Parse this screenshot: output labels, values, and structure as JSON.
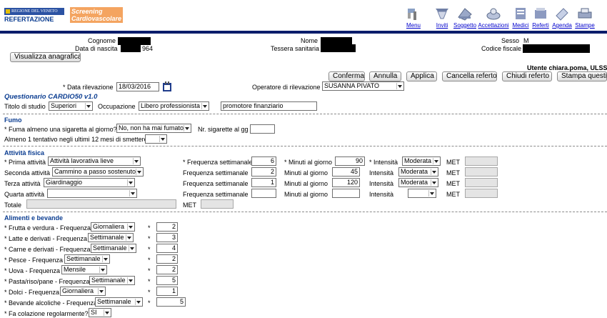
{
  "header": {
    "region_logo_text": "REGIONE DEL VENETO",
    "app_name": "REFERTAZIONE",
    "screening_line1": "Screening",
    "screening_line2": "Cardiovascolare"
  },
  "menu": [
    {
      "label": "Menu",
      "icon": "menu-icon"
    },
    {
      "label": "Inviti",
      "icon": "inviti-icon"
    },
    {
      "label": "Soggetto",
      "icon": "soggetto-icon"
    },
    {
      "label": "Accettazioni",
      "icon": "accettazioni-icon"
    },
    {
      "label": "Medici",
      "icon": "medici-icon"
    },
    {
      "label": "Referti",
      "icon": "referti-icon"
    },
    {
      "label": "Agenda",
      "icon": "agenda-icon"
    },
    {
      "label": "Stampe",
      "icon": "stampe-icon"
    }
  ],
  "patient": {
    "cognome_label": "Cognome",
    "nascita_label": "Data di nascita",
    "nascita_value": "964",
    "nome_label": "Nome",
    "tessera_label": "Tessera sanitaria",
    "sesso_label": "Sesso",
    "sesso_value": "M",
    "cf_label": "Codice fiscale",
    "anagrafica_button": "Visualizza anagrafica"
  },
  "user_line": "Utente chiara.poma, ULSS",
  "actions": {
    "conferma": "Conferma",
    "annulla": "Annulla",
    "applica": "Applica",
    "cancella": "Cancella referto",
    "chiudi": "Chiudi referto",
    "stampa": "Stampa questio"
  },
  "rilevazione": {
    "date_label": "* Data rilevazione",
    "date_value": "18/03/2016",
    "operatore_label": "Operatore di rilevazione",
    "operatore_value": "SUSANNA PIVATO"
  },
  "questionnaire_title": "Questionario CARDIO50 v1.0",
  "studio": {
    "titolo_label": "Titolo di studio",
    "titolo_value": "Superiori",
    "occupazione_label": "Occupazione",
    "occupazione_value": "Libero professionista",
    "occupazione_text": "promotore finanziario"
  },
  "fumo": {
    "title": "Fumo",
    "q1_label": "* Fuma almeno una sigaretta al giorno?",
    "q1_value": "No, non ha mai fumato",
    "nsig_label": "Nr. sigarette al gg",
    "nsig_value": "",
    "q2_label": "Almeno 1 tentativo negli ultimi 12 mesi di smettere",
    "q2_value": ""
  },
  "attivita": {
    "title": "Attività fisica",
    "rows": [
      {
        "label": "* Prima attività",
        "activity": "Attività lavorativa lieve",
        "freq_label": "* Frequenza settimanale",
        "freq": "6",
        "min_label": "* Minuti al giorno",
        "min": "90",
        "int_label": "* Intensità",
        "intensity": "Moderata",
        "met_label": "MET"
      },
      {
        "label": "Seconda attività",
        "activity": "Cammino a passo sostenuto",
        "freq_label": "Frequenza settimanale",
        "freq": "2",
        "min_label": "Minuti al giorno",
        "min": "45",
        "int_label": "Intensità",
        "intensity": "Moderata",
        "met_label": "MET"
      },
      {
        "label": "Terza attività",
        "activity": "Giardinaggio",
        "freq_label": "Frequenza settimanale",
        "freq": "1",
        "min_label": "Minuti al giorno",
        "min": "120",
        "int_label": "Intensità",
        "intensity": "Moderata",
        "met_label": "MET"
      },
      {
        "label": "Quarta attività",
        "activity": "",
        "freq_label": "Frequenza settimanale",
        "freq": "",
        "min_label": "Minuti al giorno",
        "min": "",
        "int_label": "Intensità",
        "intensity": "",
        "met_label": "MET"
      }
    ],
    "totale_label": "Totale",
    "totale_met_label": "MET"
  },
  "alimenti": {
    "title": "Alimenti e bevande",
    "rows": [
      {
        "label": "* Frutta e verdura - Frequenza",
        "freq": "Giornaliera",
        "qty": "2"
      },
      {
        "label": "* Latte e derivati - Frequenza",
        "freq": "Settimanale",
        "qty": "3"
      },
      {
        "label": "* Carne e derivati - Frequenza",
        "freq": "Settimanale",
        "qty": "4"
      },
      {
        "label": "* Pesce - Frequenza",
        "freq": "Settimanale",
        "qty": "2"
      },
      {
        "label": "* Uova - Frequenza",
        "freq": "Mensile",
        "qty": "2"
      },
      {
        "label": "* Pasta/riso/pane - Frequenza",
        "freq": "Settimanale",
        "qty": "5"
      },
      {
        "label": "* Dolci - Frequenza",
        "freq": "Giornaliera",
        "qty": "1"
      },
      {
        "label": "* Bevande alcoliche - Frequenza",
        "freq": "Settimanale",
        "qty": "5"
      }
    ],
    "colazione_label": "* Fa colazione regolarmente?",
    "colazione_value": "SI"
  },
  "colors": {
    "topbar": "#0a1d6b",
    "section_title": "#0b3d91",
    "screening_bg": "#f4a460",
    "screening_text": "#ffffff"
  }
}
